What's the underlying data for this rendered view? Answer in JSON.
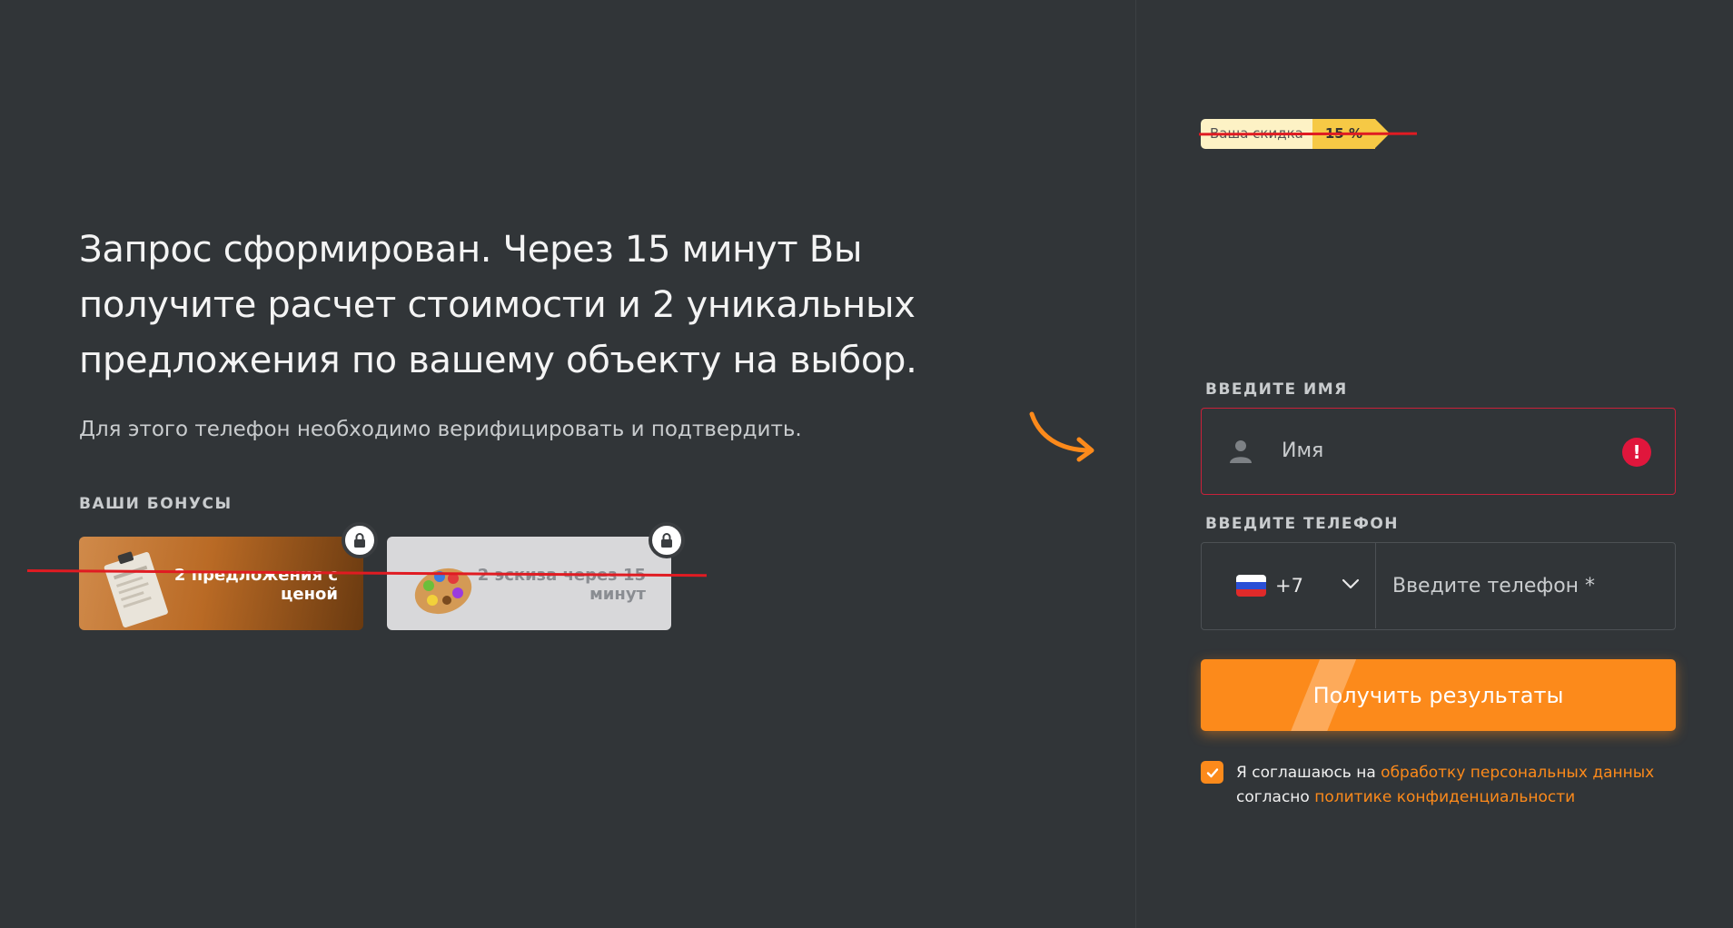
{
  "heading": "Запрос сформирован. Через 15 минут Вы получите расчет стоимости и 2 уникальных предложения по вашему объекту на выбор.",
  "subtext": "Для этого телефон необходимо верифицировать и подтвердить.",
  "bonuses": {
    "title": "ВАШИ БОНУСЫ",
    "items": [
      {
        "label": "2 предложения с ценой",
        "art": "clipboard-document"
      },
      {
        "label": "2 эскиза через 15 минут",
        "art": "paint-palette"
      }
    ]
  },
  "discount": {
    "label": "Ваша скидка",
    "value": "15 %"
  },
  "form": {
    "name_label": "ВВЕДИТЕ ИМЯ",
    "name_placeholder": "Имя",
    "phone_label": "ВВЕДИТЕ ТЕЛЕФОН",
    "country_code": "+7",
    "phone_placeholder": "Введите телефон *",
    "submit_label": "Получить результаты"
  },
  "consent": {
    "prefix": "Я соглашаюсь на ",
    "link1": "обработку персональных данных",
    "middle": "согласно ",
    "link2": "политике конфиденциальности",
    "checked": true
  },
  "colors": {
    "accent": "#fc8a1b",
    "error": "#e0163c",
    "background": "#313538",
    "strike": "#e01b22"
  }
}
